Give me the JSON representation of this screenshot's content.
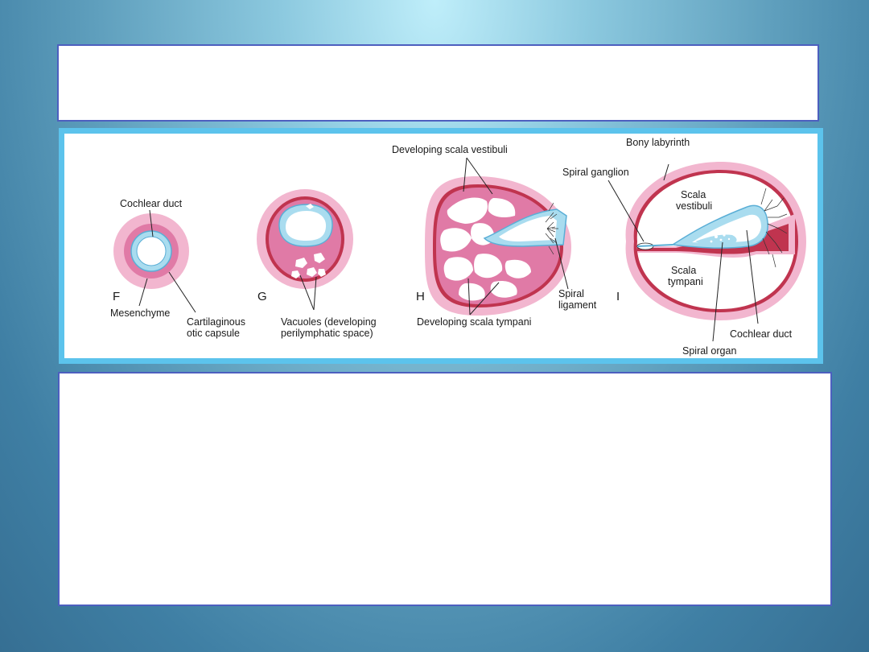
{
  "slide": {
    "title_text": "",
    "body_text": ""
  },
  "figure": {
    "stages": [
      {
        "id": "F",
        "label": "F",
        "captions": [
          "Cochlear duct",
          "Mesenchyme",
          "Cartilaginous",
          "otic capsule"
        ]
      },
      {
        "id": "G",
        "label": "G",
        "captions": [
          "Vacuoles (developing",
          "perilymphatic space)"
        ]
      },
      {
        "id": "H",
        "label": "H",
        "captions": [
          "Developing scala vestibuli",
          "Spiral",
          "ligament",
          "Developing scala tympani"
        ]
      },
      {
        "id": "I",
        "label": "I",
        "captions": [
          "Bony labyrinth",
          "Spiral ganglion",
          "Scala",
          "vestibuli",
          "Scala",
          "tympani",
          "Cochlear duct",
          "Spiral organ"
        ]
      }
    ],
    "colors": {
      "outer_pink": "#f2b6cf",
      "mid_pink": "#e07aa6",
      "dark_red": "#c0344f",
      "duct_blue": "#a9dcef",
      "duct_outline": "#5aaed6",
      "panel_border": "#5cc3ec"
    }
  }
}
